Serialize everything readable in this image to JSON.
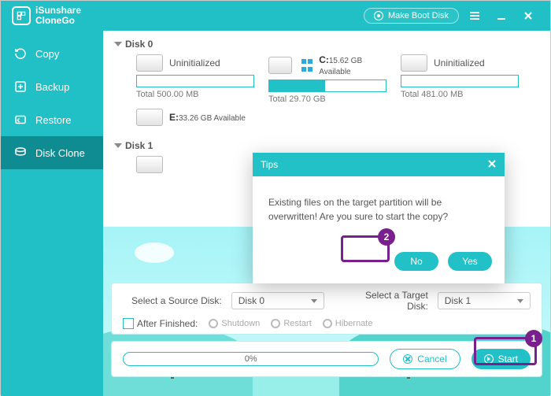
{
  "brand": {
    "line1": "iSunshare",
    "line2": "CloneGo"
  },
  "titlebar": {
    "makeboot": "Make Boot Disk"
  },
  "sidebar": {
    "items": [
      {
        "label": "Copy"
      },
      {
        "label": "Backup"
      },
      {
        "label": "Restore"
      },
      {
        "label": "Disk Clone"
      }
    ]
  },
  "disks": {
    "d0": {
      "name": "Disk 0",
      "parts": [
        {
          "name": "Uninitialized",
          "sub": "",
          "total": "Total 500.00 MB",
          "fill": 0
        },
        {
          "name": "C:",
          "sub": "15.62 GB Available",
          "total": "Total 29.70 GB",
          "fill": 48,
          "win": true
        },
        {
          "name": "Uninitialized",
          "sub": "",
          "total": "Total 481.00 MB",
          "fill": 0
        }
      ],
      "row2": [
        {
          "name": "E:",
          "sub": "33.26 GB Available",
          "total": "",
          "fill": 0
        }
      ]
    },
    "d1": {
      "name": "Disk 1"
    }
  },
  "select": {
    "src_label": "Select a Source Disk:",
    "tgt_label": "Select a Target Disk:",
    "src_value": "Disk 0",
    "tgt_value": "Disk 1",
    "after_label": "After Finished:",
    "opts": {
      "shutdown": "Shutdown",
      "restart": "Restart",
      "hibernate": "Hibernate"
    }
  },
  "action": {
    "progress": "0%",
    "cancel": "Cancel",
    "start": "Start"
  },
  "dialog": {
    "title": "Tips",
    "message": "Existing files on the target partition will be overwritten! Are you sure to start the copy?",
    "no": "No",
    "yes": "Yes"
  },
  "callouts": {
    "one": "1",
    "two": "2"
  }
}
